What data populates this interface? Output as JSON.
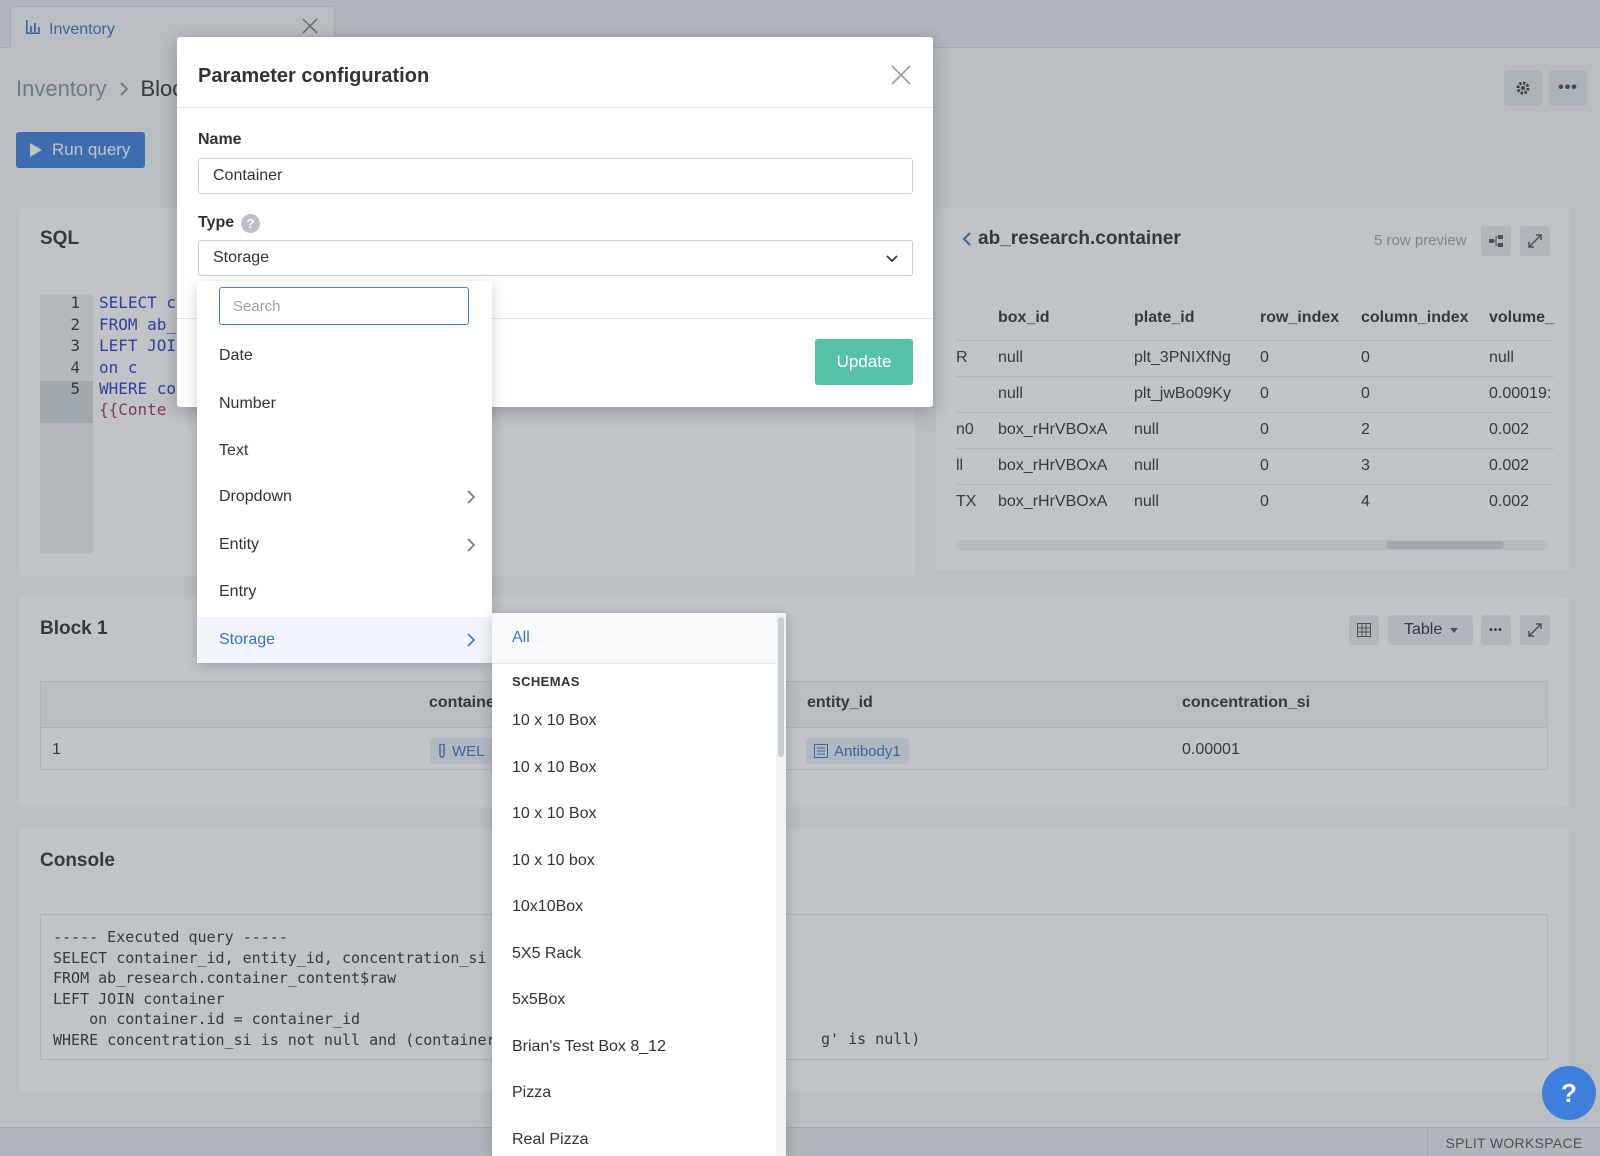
{
  "tab": {
    "label": "Inventory"
  },
  "breadcrumb": {
    "parent": "Inventory",
    "current": "Bloc"
  },
  "toolbar": {
    "run_label": "Run query"
  },
  "sql_panel": {
    "title": "SQL",
    "lines": [
      {
        "no": "1",
        "code": "SELECT c"
      },
      {
        "no": "2",
        "code": "FROM ab_r"
      },
      {
        "no": "3",
        "code": "LEFT JOIN"
      },
      {
        "no": "4",
        "code": "    on c"
      },
      {
        "no": "5",
        "code": "WHERE co"
      },
      {
        "no": "",
        "code": "    {{Conte"
      }
    ]
  },
  "preview_panel": {
    "title": "ab_research.container",
    "preview_label": "5 row preview",
    "columns": [
      "",
      "box_id",
      "plate_id",
      "row_index",
      "column_index",
      "volume_"
    ],
    "rows": [
      [
        "R",
        "null",
        "plt_3PNIXfNg",
        "0",
        "0",
        "null"
      ],
      [
        "",
        "null",
        "plt_jwBo09Ky",
        "0",
        "0",
        "0.00019:"
      ],
      [
        "n0",
        "box_rHrVBOxA",
        "null",
        "0",
        "2",
        "0.002"
      ],
      [
        "ll",
        "box_rHrVBOxA",
        "null",
        "0",
        "3",
        "0.002"
      ],
      [
        "TX",
        "box_rHrVBOxA",
        "null",
        "0",
        "4",
        "0.002"
      ]
    ]
  },
  "block": {
    "title": "Block 1",
    "view_label": "Table",
    "columns": [
      "containe",
      "entity_id",
      "concentration_si"
    ],
    "row": {
      "index": "1",
      "container": "WEL",
      "entity": "Antibody1",
      "concentration": "0.00001"
    }
  },
  "console": {
    "title": "Console",
    "lines": [
      "----- Executed query -----",
      "SELECT container_id, entity_id, concentration_si",
      "FROM ab_research.container_content$raw",
      "LEFT JOIN container",
      "    on container.id = container_id",
      "WHERE concentration_si is not null and (container_i",
      "g' is null)"
    ]
  },
  "footer": {
    "split_label": "SPLIT WORKSPACE",
    "help_label": "?"
  },
  "modal": {
    "title": "Parameter configuration",
    "name_label": "Name",
    "name_value": "Container",
    "type_label": "Type",
    "type_help": "?",
    "type_value": "Storage",
    "update_label": "Update"
  },
  "type_menu": {
    "search_placeholder": "Search",
    "items": [
      {
        "label": "Date",
        "submenu": false
      },
      {
        "label": "Number",
        "submenu": false
      },
      {
        "label": "Text",
        "submenu": false
      },
      {
        "label": "Dropdown",
        "submenu": true
      },
      {
        "label": "Entity",
        "submenu": true
      },
      {
        "label": "Entry",
        "submenu": false
      },
      {
        "label": "Storage",
        "submenu": true,
        "active": true
      }
    ]
  },
  "storage_submenu": {
    "all_label": "All",
    "heading": "SCHEMAS",
    "items": [
      "10 x 10 Box",
      "10 x 10 Box",
      "10 x 10 Box",
      "10 x 10 box",
      "10x10Box",
      "5X5 Rack",
      "5x5Box",
      "Brian's Test Box 8_12",
      "Pizza",
      "Real Pizza"
    ]
  },
  "colors": {
    "accent": "#3f7fdc",
    "link": "#3a73c9",
    "update": "#55c1a8"
  }
}
